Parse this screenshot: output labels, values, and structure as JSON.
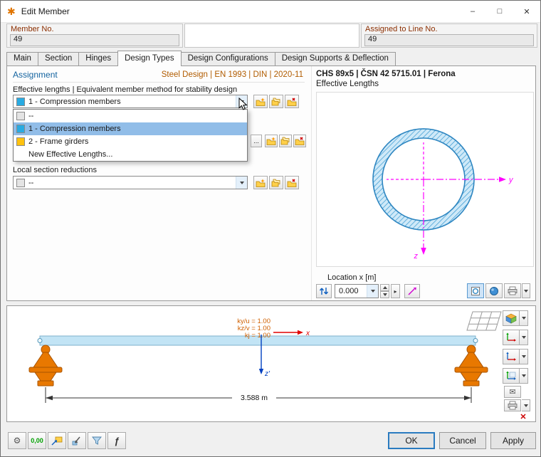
{
  "window": {
    "title": "Edit Member",
    "minimize": "–",
    "maximize": "□",
    "close": "✕"
  },
  "header": {
    "member_no_label": "Member No.",
    "member_no_value": "49",
    "assigned_label": "Assigned to Line No.",
    "assigned_value": "49"
  },
  "tabs": [
    "Main",
    "Section",
    "Hinges",
    "Design Types",
    "Design Configurations",
    "Design Supports & Deflection"
  ],
  "active_tab": "Design Types",
  "assignment": {
    "title": "Assignment",
    "standard": "Steel Design | EN 1993 | DIN | 2020-11",
    "effective_label": "Effective lengths | Equivalent member method for stability design",
    "effective_value": "1 - Compression members",
    "effective_items": [
      {
        "label": "--",
        "chip": "#e4e4e4"
      },
      {
        "label": "1 - Compression members",
        "chip": "#29abe2",
        "selected": true
      },
      {
        "label": "2 - Frame girders",
        "chip": "#ffc20e"
      },
      {
        "label": "New Effective Lengths...",
        "chip": null
      }
    ],
    "more_button": "...",
    "local_label": "Local section reductions",
    "local_value": "--",
    "local_chip": "#e4e4e4"
  },
  "section": {
    "title": "CHS 89x5 | ČSN 42 5715.01 | Ferona",
    "subtitle": "Effective Lengths",
    "axis_y": "y",
    "axis_z": "z",
    "location_label": "Location x [m]",
    "location_value": "0.000"
  },
  "member_view": {
    "k_labels": [
      "ky/u = 1.00",
      "kz/v = 1.00",
      "kj = 1.00"
    ],
    "axis_x": "x",
    "axis_z": "z'",
    "dimension": "3.588 m"
  },
  "toolbar": {
    "decimals_text": "0,00"
  },
  "buttons": {
    "ok": "OK",
    "cancel": "Cancel",
    "apply": "Apply"
  },
  "colors": {
    "accent_blue": "#1464a0",
    "group_label_red": "#8b2e00",
    "standard_orange": "#b15c00",
    "selection_blue": "#91bde8",
    "section_blue": "#2e86c1",
    "magenta": "#ff00ff",
    "beam_blue": "#c2e4f5",
    "support_orange": "#e87800",
    "k_label_orange": "#d06000"
  }
}
